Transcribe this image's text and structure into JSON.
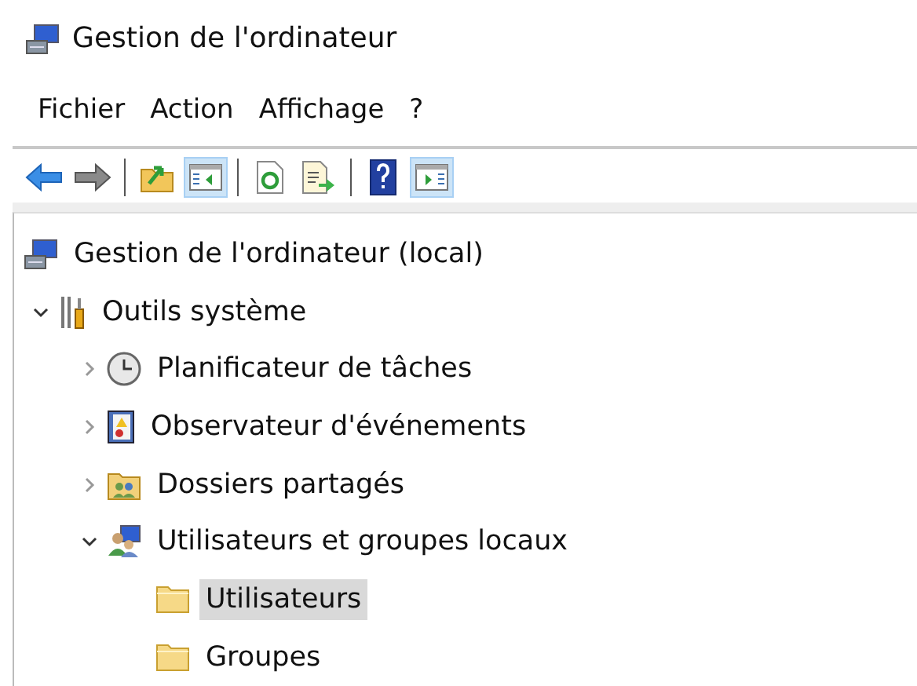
{
  "window": {
    "title": "Gestion de l'ordinateur"
  },
  "menu": [
    {
      "label": "Fichier"
    },
    {
      "label": "Action"
    },
    {
      "label": "Affichage"
    },
    {
      "label": "?"
    }
  ],
  "toolbar": [
    {
      "kind": "back",
      "pressed": false
    },
    {
      "kind": "forward",
      "pressed": false
    },
    {
      "kind": "separator"
    },
    {
      "kind": "up",
      "pressed": false
    },
    {
      "kind": "tree-toggle",
      "pressed": true
    },
    {
      "kind": "separator"
    },
    {
      "kind": "refresh",
      "pressed": false
    },
    {
      "kind": "export",
      "pressed": false
    },
    {
      "kind": "separator"
    },
    {
      "kind": "help",
      "pressed": false
    },
    {
      "kind": "action-pane",
      "pressed": true
    }
  ],
  "tree": [
    {
      "label": "Gestion de l'ordinateur (local)",
      "kind": "computer",
      "selected": false,
      "children": [
        {
          "label": "Outils système",
          "kind": "tools",
          "expanded": true,
          "selected": false,
          "children": [
            {
              "label": "Planificateur de tâches",
              "kind": "clock",
              "expanded": false,
              "selected": false
            },
            {
              "label": "Observateur d'événements",
              "kind": "log",
              "expanded": false,
              "selected": false
            },
            {
              "label": "Dossiers partagés",
              "kind": "shared",
              "expanded": false,
              "selected": false
            },
            {
              "label": "Utilisateurs et groupes locaux",
              "kind": "users",
              "expanded": true,
              "selected": false,
              "children": [
                {
                  "label": "Utilisateurs",
                  "kind": "folder",
                  "selected": true
                },
                {
                  "label": "Groupes",
                  "kind": "folder",
                  "selected": false
                }
              ]
            }
          ]
        }
      ]
    }
  ]
}
